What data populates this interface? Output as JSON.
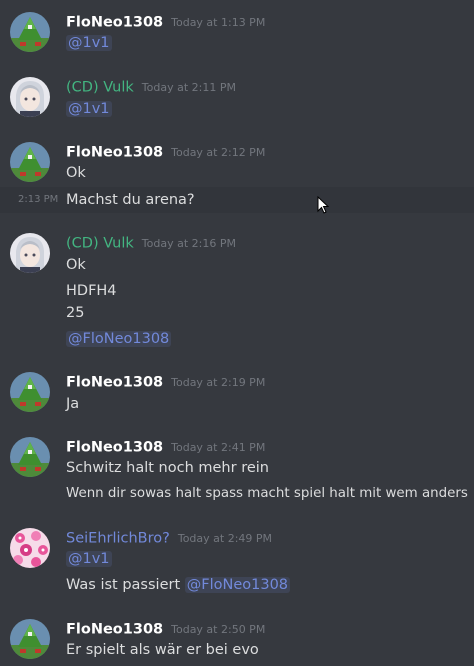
{
  "messages": [
    {
      "author": "FloNeo1308",
      "author_color": "#ffffff",
      "avatar": "tree-avatar",
      "timestamp": "Today at 1:13 PM",
      "lines": [
        {
          "mention": "@1v1"
        }
      ]
    },
    {
      "author": "(CD) Vulk",
      "author_color": "#43b581",
      "avatar": "anime-avatar",
      "timestamp": "Today at 2:11 PM",
      "lines": [
        {
          "mention": "@1v1"
        }
      ]
    },
    {
      "author": "FloNeo1308",
      "author_color": "#ffffff",
      "avatar": "tree-avatar",
      "timestamp": "Today at 2:12 PM",
      "lines": [
        {
          "text": "Ok"
        },
        {
          "text": "Machst du arena?",
          "hover_time": "2:13 PM"
        }
      ]
    },
    {
      "author": "(CD) Vulk",
      "author_color": "#43b581",
      "avatar": "anime-avatar",
      "timestamp": "Today at 2:16 PM",
      "lines": [
        {
          "text": "Ok"
        },
        {
          "text": "HDFH4"
        },
        {
          "text": "25"
        },
        {
          "mention": "@FloNeo1308"
        }
      ]
    },
    {
      "author": "FloNeo1308",
      "author_color": "#ffffff",
      "avatar": "tree-avatar",
      "timestamp": "Today at 2:19 PM",
      "lines": [
        {
          "text": "Ja"
        }
      ]
    },
    {
      "author": "FloNeo1308",
      "author_color": "#ffffff",
      "avatar": "tree-avatar",
      "timestamp": "Today at 2:41 PM",
      "lines": [
        {
          "text": "Schwitz halt noch mehr rein"
        },
        {
          "text": "Wenn dir sowas halt spass macht spiel halt mit wem anders"
        }
      ]
    },
    {
      "author": "SeiEhrlichBro?",
      "author_color": "#7289da",
      "avatar": "pink-pattern-avatar",
      "timestamp": "Today at 2:49 PM",
      "lines": [
        {
          "mention": "@1v1"
        },
        {
          "text": "Was ist passiert ",
          "mention": "@FloNeo1308"
        }
      ]
    },
    {
      "author": "FloNeo1308",
      "author_color": "#ffffff",
      "avatar": "tree-avatar",
      "timestamp": "Today at 2:50 PM",
      "lines": [
        {
          "text": "Er spielt als wär er bei evo"
        }
      ]
    }
  ]
}
